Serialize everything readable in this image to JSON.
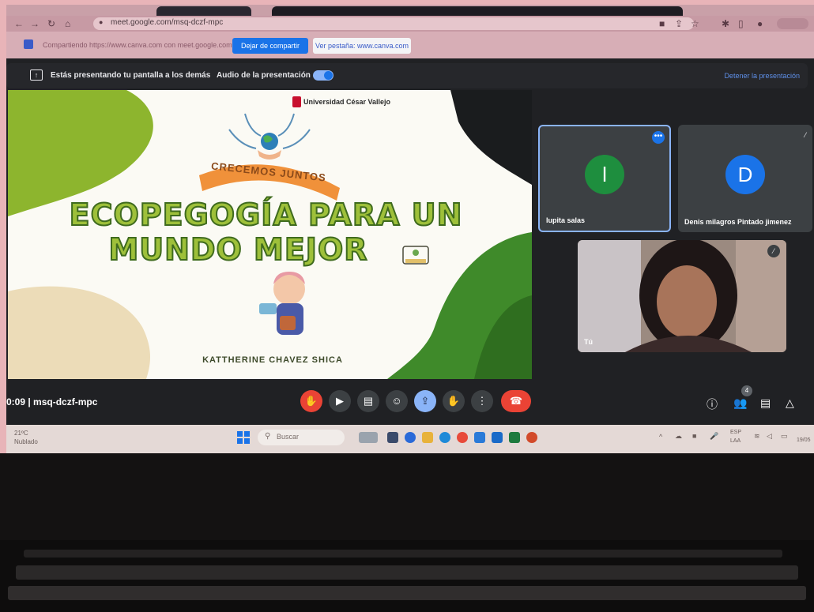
{
  "browser": {
    "url": "meet.google.com/msq-dczf-mpc"
  },
  "share_bar": {
    "sharing_text": "Compartiendo https://www.canva.com con meet.google.com",
    "stop_sharing_label": "Dejar de compartir",
    "view_tab_label": "Ver pestaña: www.canva.com"
  },
  "presentation_bar": {
    "presenting_text": "Estás presentando tu pantalla a los demás",
    "audio_label": "Audio de la presentación",
    "stop_presenting_label": "Detener la presentación"
  },
  "slide": {
    "university": "Universidad César Vallejo",
    "ribbon": "CRECEMOS JUNTOS",
    "title_line1": "ECOPEGOGÍA PARA UN",
    "title_line2": "MUNDO MEJOR",
    "author": "KATTHERINE CHAVEZ SHICA"
  },
  "participants": [
    {
      "initial": "l",
      "name": "lupita salas",
      "avatar_color": "#1e8e3e"
    },
    {
      "initial": "D",
      "name": "Denis milagros Pintado jimenez",
      "avatar_color": "#1a73e8"
    },
    {
      "name": "Tú"
    }
  ],
  "meeting": {
    "time_and_code": "0:09  |  msq-dczf-mpc",
    "people_count": "4"
  },
  "taskbar": {
    "temperature": "21ºC",
    "condition": "Nublado",
    "search_placeholder": "Buscar",
    "lang_code": "ESP",
    "lang_layout": "LAA",
    "date": "19/05"
  },
  "colors": {
    "meet_blue": "#1a73e8",
    "hangup_red": "#ea4335",
    "slide_green": "#9ec03a"
  }
}
